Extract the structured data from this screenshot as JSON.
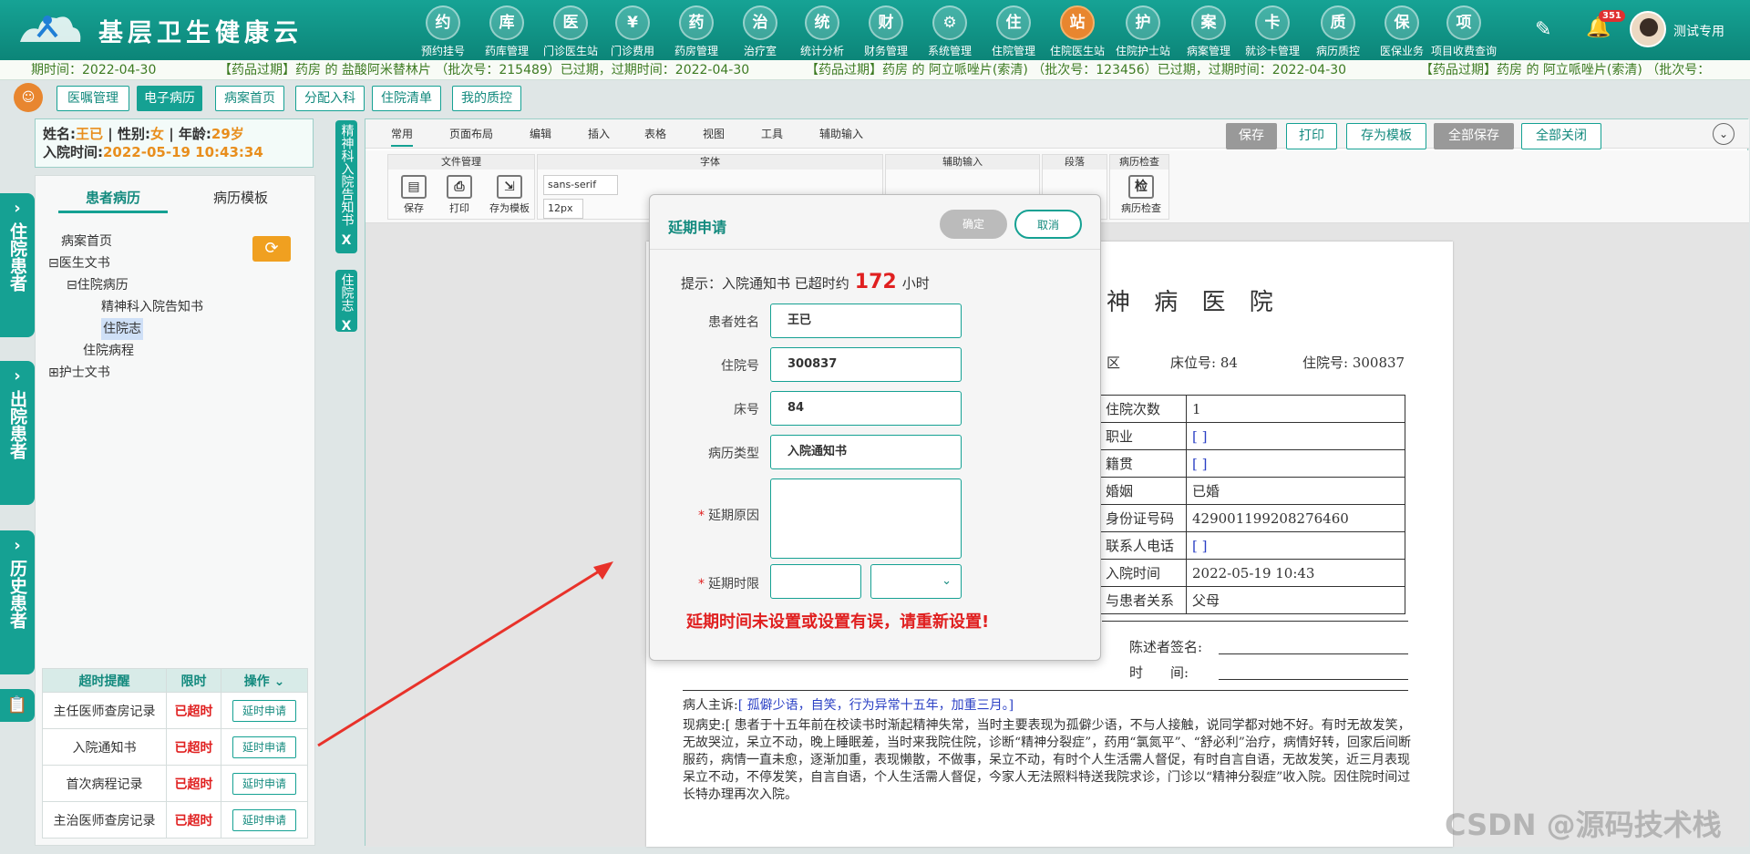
{
  "app": {
    "title": "基层卫生健康云",
    "username": "测试专用",
    "notification_count": "351"
  },
  "nav": [
    {
      "label": "预约挂号",
      "icon": "calendar-icon",
      "glyph": "约"
    },
    {
      "label": "药库管理",
      "icon": "warehouse-icon",
      "glyph": "库"
    },
    {
      "label": "门诊医生站",
      "icon": "doctor-icon",
      "glyph": "医"
    },
    {
      "label": "门诊费用",
      "icon": "yen-icon",
      "glyph": "¥"
    },
    {
      "label": "药房管理",
      "icon": "pill-icon",
      "glyph": "药"
    },
    {
      "label": "治疗室",
      "icon": "treatment-icon",
      "glyph": "治"
    },
    {
      "label": "统计分析",
      "icon": "chart-icon",
      "glyph": "统"
    },
    {
      "label": "财务管理",
      "icon": "finance-icon",
      "glyph": "财"
    },
    {
      "label": "系统管理",
      "icon": "gear-icon",
      "glyph": "⚙"
    },
    {
      "label": "住院管理",
      "icon": "bed-icon",
      "glyph": "住"
    },
    {
      "label": "住院医生站",
      "icon": "inpatient-doctor-icon",
      "glyph": "站",
      "active": true
    },
    {
      "label": "住院护士站",
      "icon": "nurse-icon",
      "glyph": "护"
    },
    {
      "label": "病案管理",
      "icon": "record-icon",
      "glyph": "案"
    },
    {
      "label": "就诊卡管理",
      "icon": "card-icon",
      "glyph": "卡"
    },
    {
      "label": "病历质控",
      "icon": "quality-icon",
      "glyph": "质"
    },
    {
      "label": "医保业务",
      "icon": "insurance-icon",
      "glyph": "保"
    },
    {
      "label": "项目收费查询",
      "icon": "search-fee-icon",
      "glyph": "项"
    }
  ],
  "ticker": [
    "期时间：2022-04-30",
    "【药品过期】药房 的 盐酸阿米替林片 （批次号：215489）已过期，过期时间：2022-04-30",
    "【药品过期】药房 的 阿立哌唑片(索清) （批次号：123456）已过期，过期时间：2022-04-30",
    "【药品过期】药房 的 阿立哌唑片(索清) （批次号："
  ],
  "tabs": [
    "医嘱管理",
    "电子病历",
    "病案首页",
    "分配入科",
    "住院清单",
    "我的质控"
  ],
  "patient": {
    "name_label": "姓名:",
    "name": "王已",
    "sex_label": "| 性别:",
    "sex": "女",
    "age_label": "| 年龄:",
    "age": "29岁",
    "admit_label": "入院时间:",
    "admit": "2022-05-19 10:43:34"
  },
  "side_tabs": [
    "住院患者",
    "出院患者",
    "历史患者"
  ],
  "left": {
    "tabs": [
      "患者病历",
      "病历模板"
    ],
    "tree": [
      {
        "label": "病案首页"
      },
      {
        "label": "医生文书",
        "prefix": "⊟"
      },
      {
        "label": "住院病历",
        "prefix": "⊟"
      },
      {
        "label": "精神科入院告知书"
      },
      {
        "label": "住院志",
        "selected": true
      },
      {
        "label": "住院病程"
      },
      {
        "label": "护士文书",
        "prefix": "⊞"
      }
    ]
  },
  "overtime": {
    "headers": [
      "超时提醒",
      "限时",
      "操作"
    ],
    "rows": [
      {
        "name": "主任医师查房记录",
        "status": "已超时",
        "action": "延时申请"
      },
      {
        "name": "入院通知书",
        "status": "已超时",
        "action": "延时申请"
      },
      {
        "name": "首次病程记录",
        "status": "已超时",
        "action": "延时申请"
      },
      {
        "name": "主治医师查房记录",
        "status": "已超时",
        "action": "延时申请"
      }
    ]
  },
  "vtabs": [
    {
      "label": "精神科入院告知书",
      "close": "X"
    },
    {
      "label": "住院志",
      "close": "X"
    }
  ],
  "editor": {
    "ribbon_tabs": [
      "常用",
      "页面布局",
      "编辑",
      "插入",
      "表格",
      "视图",
      "工具",
      "辅助输入"
    ],
    "toolbar_buttons": [
      "保存",
      "打印",
      "存为模板",
      "全部保存",
      "全部关闭"
    ],
    "groups": [
      "文件管理",
      "字体",
      "辅助输入",
      "段落",
      "病历检查"
    ],
    "file_buttons": [
      "保存",
      "打印",
      "存为模板"
    ],
    "font_family": "sans-serif",
    "font_size": "12px",
    "check_label": "病历检查",
    "check_glyph": "检"
  },
  "doc": {
    "title": "神 病 医 院",
    "header_line": {
      "ward": "区",
      "bed": "床位号: 84",
      "admission_no": "住院号: 300837"
    },
    "table": [
      {
        "label": "住院次数",
        "value": "1"
      },
      {
        "label": "职业",
        "value": "[ ]"
      },
      {
        "label": "籍贯",
        "value": "[ ]"
      },
      {
        "label": "婚姻",
        "value": "已婚"
      },
      {
        "label": "身份证号码",
        "value": "429001199208276460"
      },
      {
        "label": "联系人电话",
        "value": "[ ]"
      },
      {
        "label": "入院时间",
        "value": "2022-05-19 10:43"
      },
      {
        "label": "与患者关系",
        "value": "父母"
      }
    ],
    "narrator": "陈述者签名:",
    "time": "时　　间:",
    "complaint_label": "病人主诉:",
    "complaint": "[ 孤僻少语，自笑，行为异常十五年，加重三月。]",
    "history_label": "现病史:",
    "history": "[ 患者于十五年前在校读书时渐起精神失常，当时主要表现为孤僻少语，不与人接触，说同学都对她不好。有时无故发笑，无故哭泣，呆立不动，晚上睡眠差，当时来我院住院，诊断“精神分裂症”，药用“氯氮平”、“舒必利”治疗，病情好转，回家后间断服药，病情一直未愈，逐渐加重，表现懒散，不做事，呆立不动，有时个人生活需人督促，有时自言自语，无故发笑，近三月表现呆立不动，不停发笑，自言自语，个人生活需人督促，今家人无法照料特送我院求诊，门诊以“精神分裂症”收入院。因住院时间过长特办理再次入院。"
  },
  "modal": {
    "title": "延期申请",
    "ok": "确定",
    "cancel": "取消",
    "tip_prefix": "提示：入院通知书 已超时约",
    "tip_hours": "172",
    "tip_suffix": "小时",
    "fields": {
      "patient_name_label": "患者姓名",
      "patient_name": "王已",
      "admission_no_label": "住院号",
      "admission_no": "300837",
      "bed_label": "床号",
      "bed": "84",
      "record_type_label": "病历类型",
      "record_type": "入院通知书",
      "reason_label": "延期原因",
      "limit_label": "延期时限"
    },
    "error": "延期时间未设置或设置有误，请重新设置!"
  },
  "watermark": "CSDN @源码技术栈",
  "colors": {
    "primary": "#15a193",
    "accent": "#e8862f",
    "error": "#e02020"
  }
}
